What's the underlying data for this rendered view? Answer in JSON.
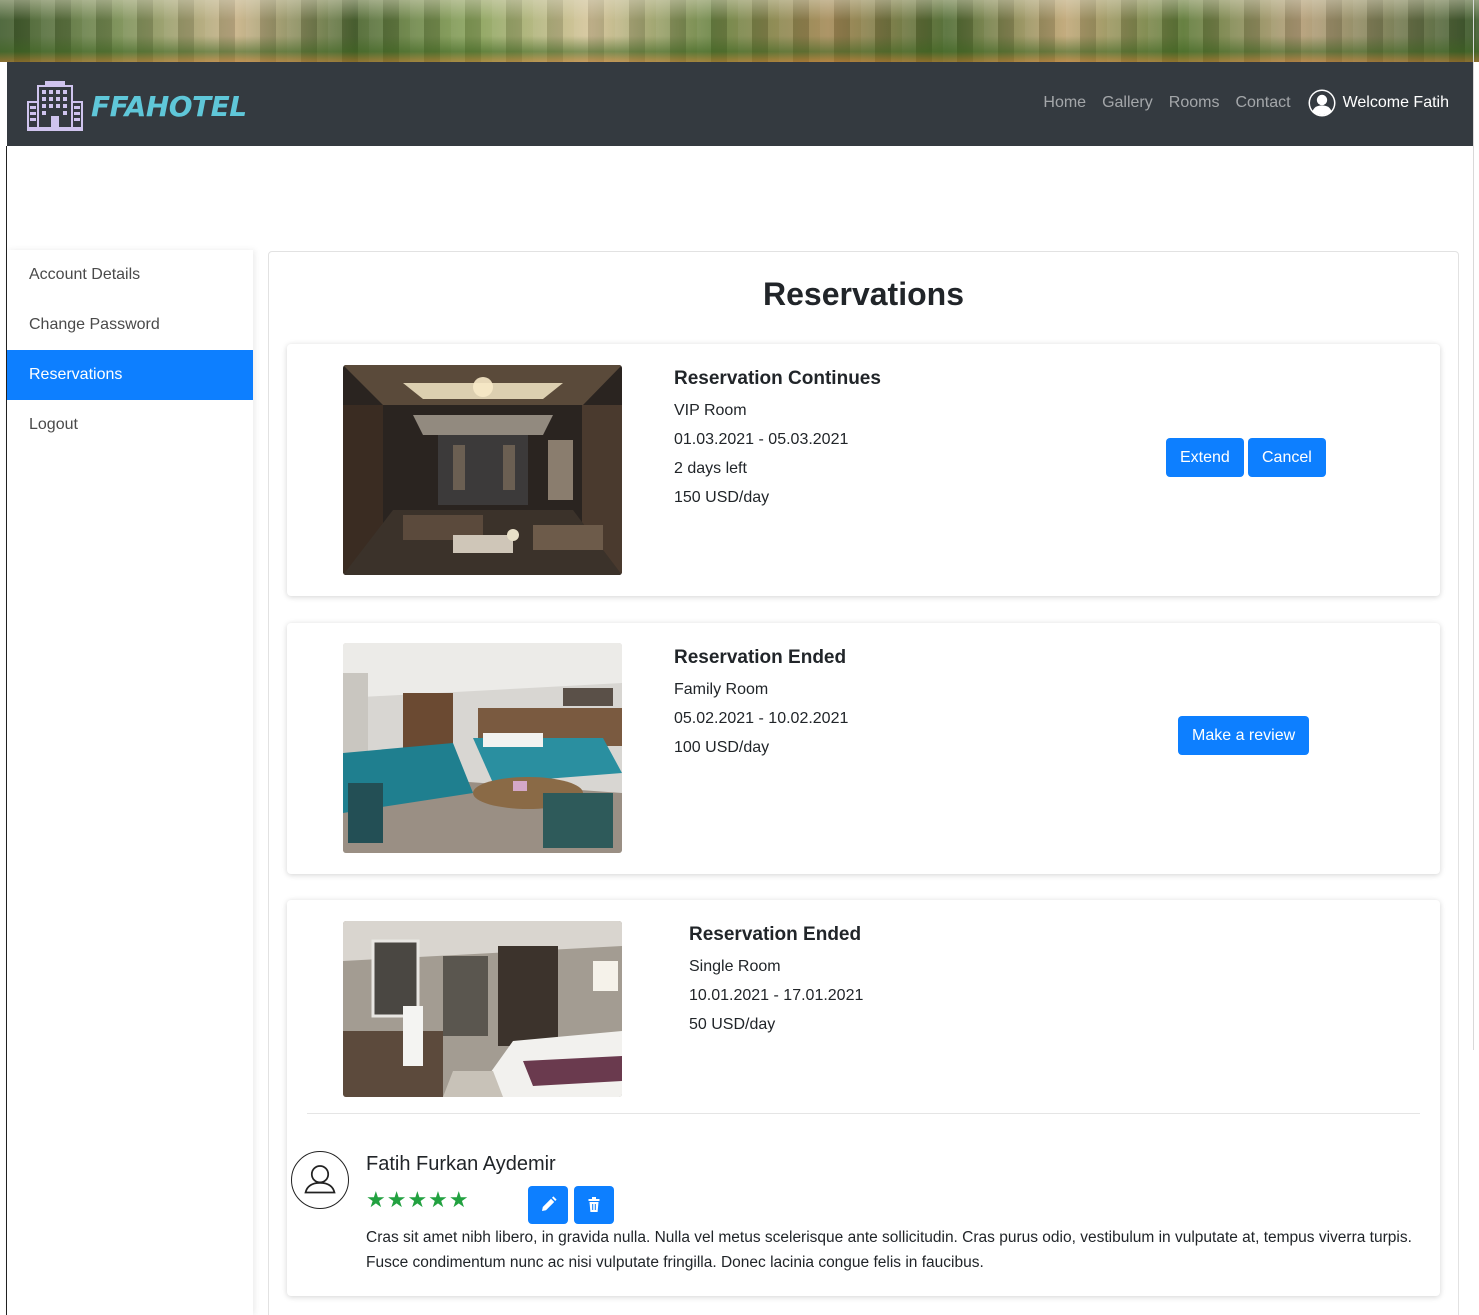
{
  "header": {
    "brand": "FFAHOTEL",
    "nav": [
      "Home",
      "Gallery",
      "Rooms",
      "Contact"
    ],
    "welcome": "Welcome Fatih"
  },
  "sidebar": {
    "items": [
      {
        "label": "Account Details",
        "active": false
      },
      {
        "label": "Change Password",
        "active": false
      },
      {
        "label": "Reservations",
        "active": true
      },
      {
        "label": "Logout",
        "active": false
      }
    ]
  },
  "main": {
    "title": "Reservations",
    "reservations": [
      {
        "status": "Reservation Continues",
        "room": "VIP Room",
        "dates": "01.03.2021 - 05.03.2021",
        "days_left": "2 days left",
        "price": "150 USD/day",
        "actions": [
          "Extend",
          "Cancel"
        ]
      },
      {
        "status": "Reservation Ended",
        "room": "Family Room",
        "dates": "05.02.2021 - 10.02.2021",
        "price": "100 USD/day",
        "actions": [
          "Make a review"
        ]
      },
      {
        "status": "Reservation Ended",
        "room": "Single Room",
        "dates": "10.01.2021 - 17.01.2021",
        "price": "50 USD/day",
        "review": {
          "author": "Fatih Furkan Aydemir",
          "rating": 5,
          "stars": "★★★★★",
          "text": "Cras sit amet nibh libero, in gravida nulla. Nulla vel metus scelerisque ante sollicitudin. Cras purus odio, vestibulum in vulputate at, tempus viverra turpis. Fusce condimentum nunc ac nisi vulputate fringilla. Donec lacinia congue felis in faucibus."
        }
      }
    ]
  },
  "colors": {
    "primary": "#0d7fff",
    "navbar": "#343a40",
    "brand": "#5fc7d9",
    "stars": "#22a140"
  }
}
